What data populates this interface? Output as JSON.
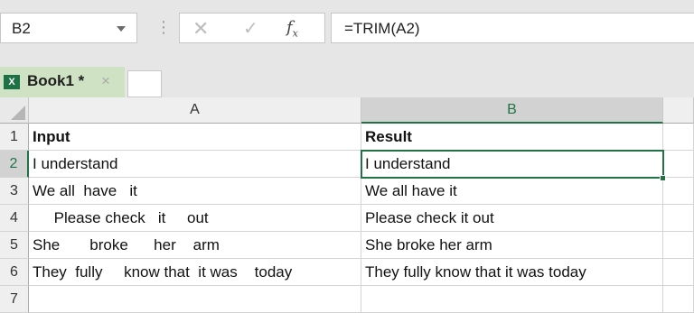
{
  "formula_bar": {
    "name_box": "B2",
    "formula": "=TRIM(A2)",
    "fx_label": "fx",
    "separator_icon": "vertical-dots",
    "cancel_icon": "x-icon",
    "enter_icon": "checkmark-icon"
  },
  "workbook_tab": {
    "name": "Book1 *",
    "close_glyph": "×",
    "accent": "#217346"
  },
  "grid": {
    "columns": [
      "A",
      "B"
    ],
    "selected_column": "B",
    "rows": [
      {
        "num": "1",
        "a": "Input",
        "b": "Result",
        "bold": true
      },
      {
        "num": "2",
        "a": "I understand",
        "b": "I understand"
      },
      {
        "num": "3",
        "a": "We all  have   it",
        "b": "We all have it"
      },
      {
        "num": "4",
        "a": "     Please check   it     out",
        "b": "Please check it out"
      },
      {
        "num": "5",
        "a": "She       broke      her    arm",
        "b": "She broke her arm"
      },
      {
        "num": "6",
        "a": "They  fully     know that  it was    today",
        "b": "They fully know that it was today"
      },
      {
        "num": "7",
        "a": "",
        "b": ""
      }
    ],
    "selected_row": "2",
    "selected_cell": "B2"
  }
}
